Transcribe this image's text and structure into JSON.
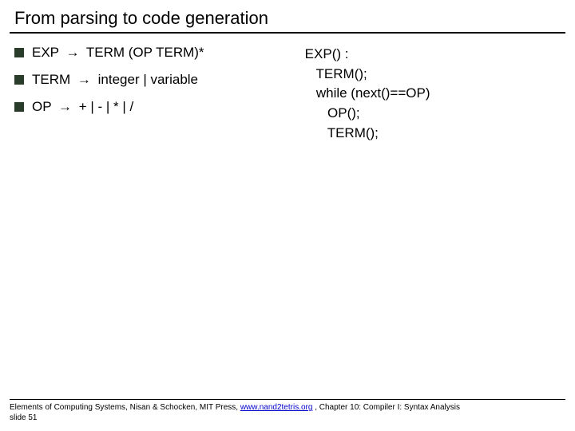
{
  "title": "From parsing to code generation",
  "bullets": [
    {
      "lhs": "EXP",
      "rhs": "TERM (OP TERM)*"
    },
    {
      "lhs": "TERM",
      "rhs": "integer | variable"
    },
    {
      "lhs": "OP",
      "rhs": "+ | - | * | /"
    }
  ],
  "arrow": "→",
  "code": {
    "l1": "EXP() :",
    "l2": "   TERM();",
    "l3": "   while (next()==OP)",
    "l4": "      OP();",
    "l5": "      TERM();"
  },
  "footer": {
    "prefix": "Elements of Computing Systems, Nisan & Schocken, MIT Press, ",
    "link": "www.nand2tetris.org",
    "suffix": " , Chapter 10: Compiler I: Syntax Analysis",
    "slide": "slide 51"
  }
}
